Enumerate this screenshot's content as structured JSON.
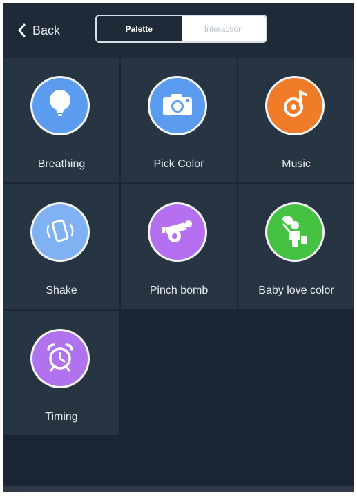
{
  "header": {
    "back_label": "Back",
    "tabs": [
      {
        "label": "Palette",
        "active": true
      },
      {
        "label": "Interaction",
        "active": false
      }
    ]
  },
  "modes": [
    {
      "label": "Breathing",
      "icon": "light-bulb-icon",
      "color": "#5b9bf0"
    },
    {
      "label": "Pick Color",
      "icon": "camera-icon",
      "color": "#5b9bf0"
    },
    {
      "label": "Music",
      "icon": "music-note-icon",
      "color": "#f07c2a"
    },
    {
      "label": "Shake",
      "icon": "shake-phone-icon",
      "color": "#7fb1f3"
    },
    {
      "label": "Pinch bomb",
      "icon": "cannon-icon",
      "color": "#b470f0"
    },
    {
      "label": "Baby love color",
      "icon": "child-icon",
      "color": "#46c242"
    },
    {
      "label": "Timing",
      "icon": "alarm-clock-icon",
      "color": "#b172f0"
    }
  ],
  "colors": {
    "background": "#1b2634",
    "tile": "#273442",
    "header": "#1e2a38"
  }
}
